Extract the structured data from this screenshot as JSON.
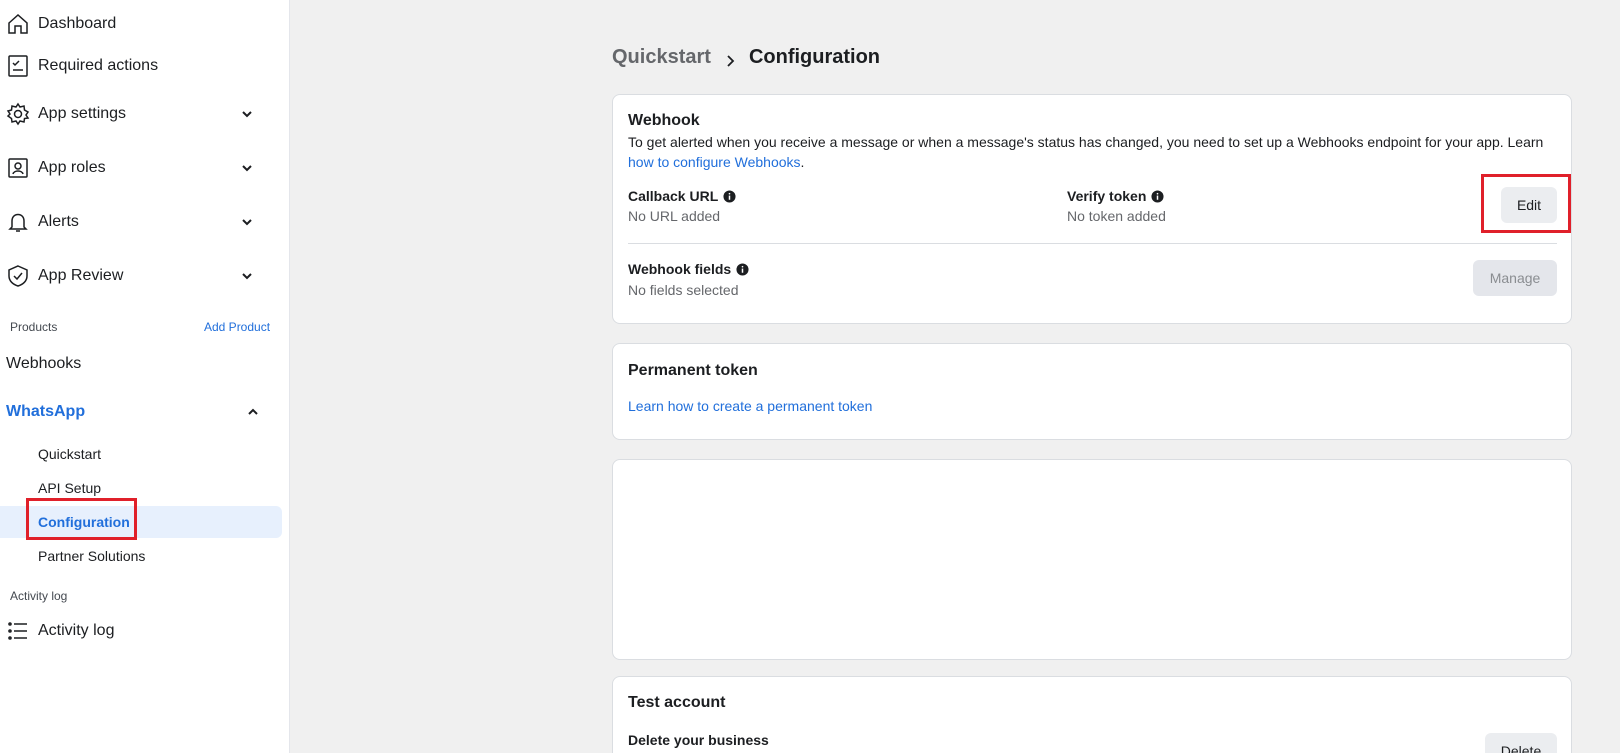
{
  "sidebar": {
    "nav": [
      {
        "label": "Dashboard",
        "icon": "home-icon"
      },
      {
        "label": "Required actions",
        "icon": "checklist-icon"
      },
      {
        "label": "App settings",
        "icon": "gear-icon"
      },
      {
        "label": "App roles",
        "icon": "id-badge-icon"
      },
      {
        "label": "Alerts",
        "icon": "bell-icon"
      },
      {
        "label": "App Review",
        "icon": "shield-check-icon"
      }
    ],
    "products_label": "Products",
    "add_product_label": "Add Product",
    "webhooks_label": "Webhooks",
    "whatsapp_label": "WhatsApp",
    "whatsapp_items": [
      "Quickstart",
      "API Setup",
      "Configuration",
      "Partner Solutions"
    ],
    "activity_section_label": "Activity log",
    "activity_item_label": "Activity log"
  },
  "breadcrumb": {
    "parent": "Quickstart",
    "current": "Configuration"
  },
  "webhook_card": {
    "title": "Webhook",
    "description": "To get alerted when you receive a message or when a message's status has changed, you need to set up a Webhooks endpoint for your app. Learn ",
    "link_text": "how to configure Webhooks",
    "link_suffix": ".",
    "callback_label": "Callback URL",
    "callback_value": "No URL added",
    "verify_label": "Verify token",
    "verify_value": "No token added",
    "edit_button": "Edit",
    "fields_label": "Webhook fields",
    "fields_value": "No fields selected",
    "manage_button": "Manage"
  },
  "token_card": {
    "title": "Permanent token",
    "link_text": "Learn how to create a permanent token"
  },
  "test_card": {
    "title": "Test account",
    "delete_label": "Delete your business",
    "delete_button": "Delete"
  },
  "colors": {
    "accent": "#216fdb",
    "highlight": "#e0202a",
    "active_bg": "#e7f0fd"
  }
}
